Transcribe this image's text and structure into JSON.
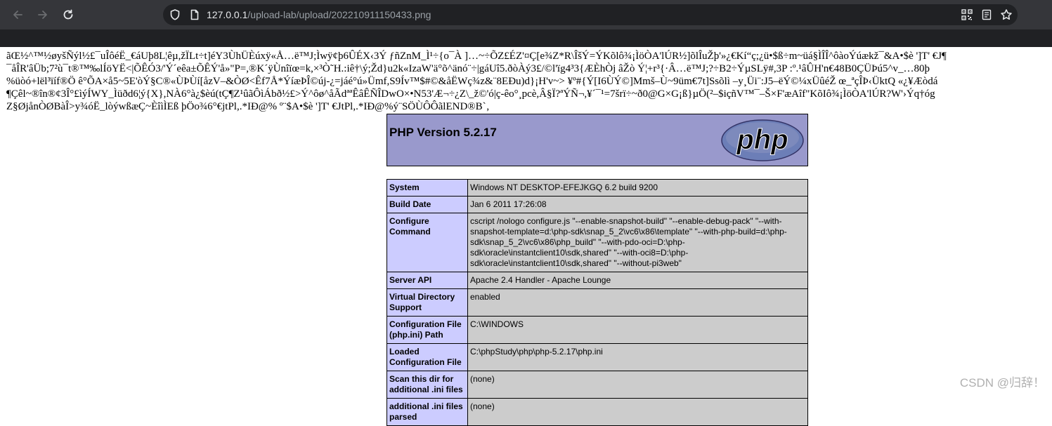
{
  "browser": {
    "url_host": "127.0.0.1",
    "url_path": "/upload-lab/upload/202210911150433.png"
  },
  "garbage_lines": [
    "ãŒ½^™½øyšÑýl½£¯uÎôéË_€áUþ8L¦êµ,žÏLt÷t]éY3ÙhÜÈúxÿ«Å…ë™J;Ìwÿ¢þ6ÛÉX‹3Ý ƒñZnM_Ì¹÷{o¯À ]…~÷ÕZ£ÉZ'¤Ç[e¾Z*R\\ÎšÝ=ÝKõlô¾¡ÌöÒA'lÚR½]õlÎuŽþ'»¿€Kí“ç;¿ü•$ß÷m~üá§ÌÎÎ^ôàoÝúækž¯&A•$è ']T' €J¶",
    "¯åÎR'âÜb;7²ù¯t®™‰lÍöYË<|ÕÊÓ3/'Ý´eêa±ÕÊÝ'å»\"P=,®K´ÿÙnîïœ=k,×³Ò˜H.:iê†\\ý;Žd}u2k«IzaW'ä°õ^änó¨÷|gáUî5.ðòÀý3£/©l'ïg4³3{ÆÈhÒj âŽò Ý¦+r³{·Â…ë™J;?÷B2÷ÝµSLÿ#,3P :º.¹âÛH'n€48B0ÇÜÞú5^v_…80þ",
    "%üòó+lël³ïíf®Ö ê°ÕA×å5~5E'òÝ§C®«ÙÞÙí[åzV–&ÒØ<Êf7Å*ÝíæÞÎ©új-¿=jáé°ú»Ümf,S9Ív™$#©&åËWç¾z&¨8EÐu)d}¡H'v~> ¥º#{Ý[I6ÙÝ©]Mmš–Ù~9üm€7t]Ssõlì –y¸Üi¨:J5–ëÝ©¼xÜûéŽ œ_ªçÎÞ‹ÜktQ «¿¥Æòdá",
    "¶Çêl~®în®¢3Î°£ìýÍWY_Ìüðd6¦ý{X},NÀ6°à¿$èú(tÇ¶Z¹ûãÔìÁbð½£>Ý^ôø^åÃdªªÊâÊÑÎDwO×•N53'Æ¬÷¿Z\\_ž©'ó|ç-êo°¸pcè,Â§Ï?ªÝÑ¬,¥´¯¹=7šrï÷~ð0@G×G¡ß}µÖ(²–$içñV™¯–Š×F'æAîf\"KõIô¾¡ÌöÒA'lÚR?W'›Ýq†óg",
    "Z§ØjånÒØBàÎ>y¾óË_lòýwßæÇ~ÈîìÌEß þÖo¾6°€jtPl,.*IÐ@% º¨$A•$è ']T' €JtPl,.*IÐ@%ý¨SÖÙÔÔãlEND®B`‚"
  ],
  "phpinfo": {
    "title": "PHP Version 5.2.17",
    "logo_text": "php",
    "rows": [
      {
        "label": "System",
        "value": "Windows NT DESKTOP-EFEJKGQ 6.2 build 9200"
      },
      {
        "label": "Build Date",
        "value": "Jan 6 2011 17:26:08"
      },
      {
        "label": "Configure Command",
        "value": "cscript /nologo configure.js \"--enable-snapshot-build\" \"--enable-debug-pack\" \"--with-snapshot-template=d:\\php-sdk\\snap_5_2\\vc6\\x86\\template\" \"--with-php-build=d:\\php-sdk\\snap_5_2\\vc6\\x86\\php_build\" \"--with-pdo-oci=D:\\php-sdk\\oracle\\instantclient10\\sdk,shared\" \"--with-oci8=D:\\php-sdk\\oracle\\instantclient10\\sdk,shared\" \"--without-pi3web\""
      },
      {
        "label": "Server API",
        "value": "Apache 2.4 Handler - Apache Lounge"
      },
      {
        "label": "Virtual Directory Support",
        "value": "enabled"
      },
      {
        "label": "Configuration File (php.ini) Path",
        "value": "C:\\WINDOWS"
      },
      {
        "label": "Loaded Configuration File",
        "value": "C:\\phpStudy\\php\\php-5.2.17\\php.ini"
      },
      {
        "label": "Scan this dir for additional .ini files",
        "value": "(none)"
      },
      {
        "label": "additional .ini files parsed",
        "value": "(none)"
      }
    ]
  },
  "watermark": "CSDN @归辞！",
  "colors": {
    "header_bg": "#9999cc",
    "label_bg": "#ccccff",
    "value_bg": "#cccccc",
    "chrome_bg": "#35363a"
  }
}
